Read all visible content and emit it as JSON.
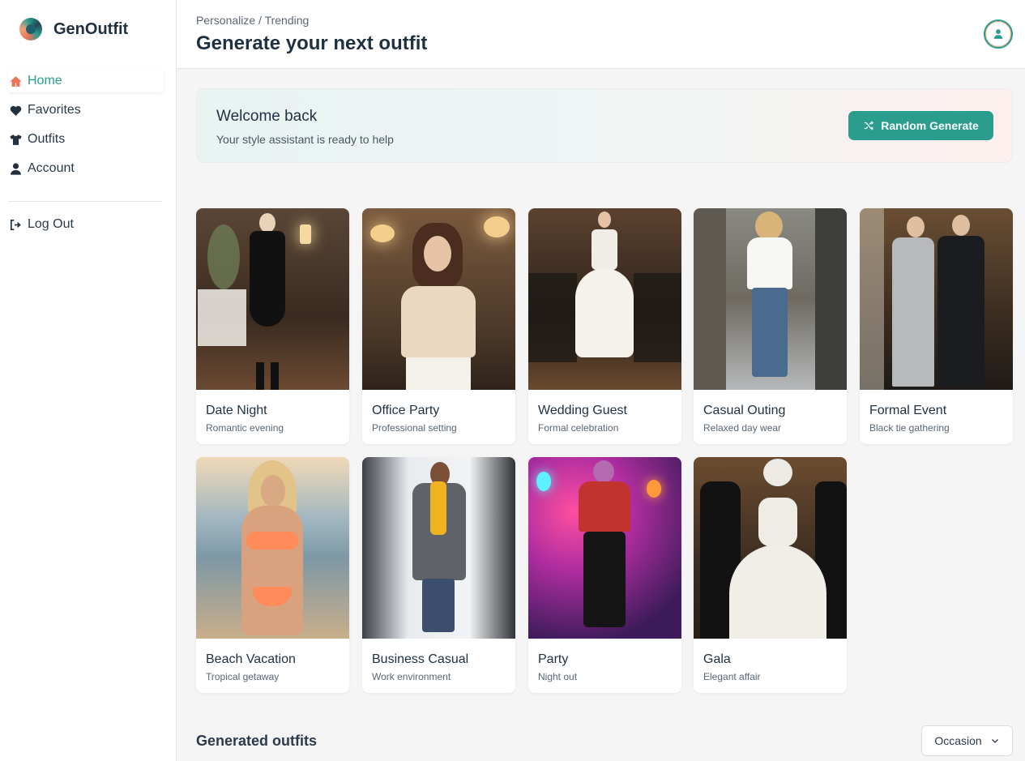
{
  "app": {
    "name": "GenOutfit"
  },
  "sidebar": {
    "items": [
      {
        "label": "Home",
        "icon": "home-icon",
        "active": true
      },
      {
        "label": "Favorites",
        "icon": "heart-icon",
        "active": false
      },
      {
        "label": "Outfits",
        "icon": "shirt-icon",
        "active": false
      },
      {
        "label": "Account",
        "icon": "user-icon",
        "active": false
      }
    ],
    "logout_label": "Log Out"
  },
  "header": {
    "breadcrumb": "Personalize / Trending",
    "title": "Generate your next outfit"
  },
  "welcome": {
    "title": "Welcome back",
    "subtitle": "Your style assistant is ready to help",
    "button_label": "Random Generate"
  },
  "occasions": [
    {
      "title": "Date Night",
      "subtitle": "Romantic evening"
    },
    {
      "title": "Office Party",
      "subtitle": "Professional setting"
    },
    {
      "title": "Wedding Guest",
      "subtitle": "Formal celebration"
    },
    {
      "title": "Casual Outing",
      "subtitle": "Relaxed day wear"
    },
    {
      "title": "Formal Event",
      "subtitle": "Black tie gathering"
    },
    {
      "title": "Beach Vacation",
      "subtitle": "Tropical getaway"
    },
    {
      "title": "Business Casual",
      "subtitle": "Work environment"
    },
    {
      "title": "Party",
      "subtitle": "Night out"
    },
    {
      "title": "Gala",
      "subtitle": "Elegant affair"
    }
  ],
  "generated": {
    "title": "Generated outfits",
    "filter_label": "Occasion"
  },
  "colors": {
    "accent": "#2a9d8f",
    "brand_coral": "#e8745a",
    "text_dark": "#1f3040"
  }
}
